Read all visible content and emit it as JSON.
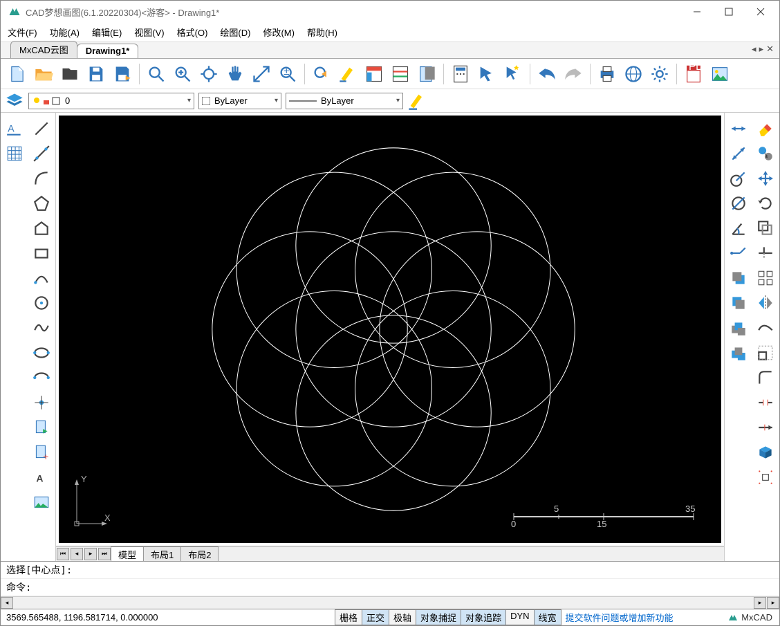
{
  "title": "CAD梦想画图(6.1.20220304)<游客> - Drawing1*",
  "menus": [
    "文件(F)",
    "功能(A)",
    "编辑(E)",
    "视图(V)",
    "格式(O)",
    "绘图(D)",
    "修改(M)",
    "帮助(H)"
  ],
  "doc_tabs": [
    {
      "label": "MxCAD云图",
      "active": false
    },
    {
      "label": "Drawing1*",
      "active": true
    }
  ],
  "propbar": {
    "layer_value": "0",
    "color_value": "ByLayer",
    "ltype_value": "ByLayer"
  },
  "layout_tabs": [
    "模型",
    "布局1",
    "布局2"
  ],
  "layout_active": 0,
  "cmd_prompt": "选择[中心点]:",
  "cmd_label": "命令:",
  "status": {
    "coords": "3569.565488, 1196.581714, 0.000000",
    "toggles": [
      {
        "t": "栅格",
        "on": false
      },
      {
        "t": "正交",
        "on": true
      },
      {
        "t": "极轴",
        "on": false
      },
      {
        "t": "对象捕捉",
        "on": true
      },
      {
        "t": "对象追踪",
        "on": true
      },
      {
        "t": "DYN",
        "on": false
      },
      {
        "t": "线宽",
        "on": true
      }
    ],
    "link": "提交软件问题或增加新功能",
    "brand": "MxCAD"
  },
  "scale": {
    "l": "5",
    "c": "0",
    "r1": "15",
    "r2": "35"
  }
}
